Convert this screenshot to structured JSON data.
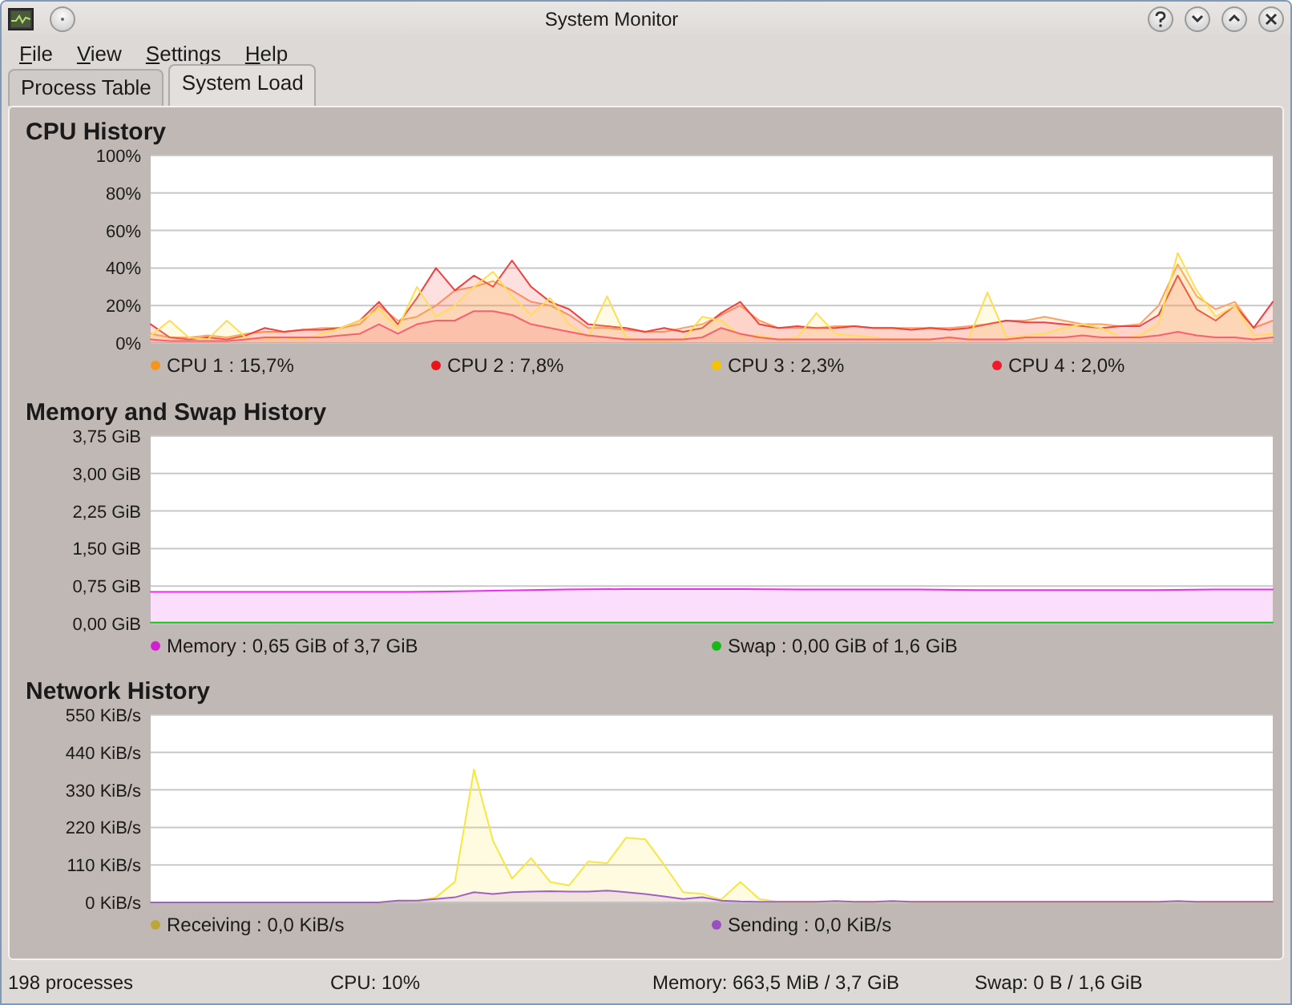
{
  "window": {
    "title": "System Monitor"
  },
  "menu": [
    "File",
    "View",
    "Settings",
    "Help"
  ],
  "tabs": [
    {
      "label": "Process Table",
      "selected": false
    },
    {
      "label": "System Load",
      "selected": true
    }
  ],
  "sections": [
    {
      "title": "CPU History",
      "legend": [
        {
          "reading": ": 15,7%",
          "color": "#f7941d"
        },
        {
          "reading": ": 7,8%",
          "color": "#e8141a"
        },
        {
          "reading": ": 2,3%",
          "color": "#f5c400"
        },
        {
          "reading": ": 2,0%",
          "color": "#ee1b2b"
        }
      ],
      "chart_data": {
        "type": "area",
        "grid": true,
        "ylim": [
          0,
          100
        ],
        "yticks": [
          {
            "value": 0,
            "label": "0%"
          },
          {
            "value": 20,
            "label": "20%"
          },
          {
            "value": 40,
            "label": "40%"
          },
          {
            "value": 60,
            "label": "60%"
          },
          {
            "value": 80,
            "label": "80%"
          },
          {
            "value": 100,
            "label": "100%"
          }
        ],
        "series": [
          {
            "name": "CPU 1",
            "color": "#ffa060",
            "values": [
              5,
              3,
              3,
              4,
              3,
              5,
              6,
              6,
              7,
              8,
              8,
              10,
              20,
              12,
              14,
              20,
              28,
              30,
              33,
              28,
              22,
              20,
              15,
              8,
              8,
              7,
              6,
              6,
              8,
              10,
              15,
              20,
              12,
              8,
              8,
              8,
              9,
              9,
              8,
              8,
              8,
              8,
              8,
              9,
              10,
              12,
              12,
              14,
              12,
              10,
              10,
              9,
              10,
              20,
              42,
              25,
              18,
              22,
              8,
              12
            ]
          },
          {
            "name": "CPU 2",
            "color": "#f04040",
            "values": [
              10,
              3,
              2,
              3,
              2,
              4,
              8,
              6,
              7,
              7,
              8,
              12,
              22,
              10,
              24,
              40,
              28,
              36,
              30,
              44,
              30,
              22,
              18,
              10,
              9,
              8,
              6,
              8,
              6,
              8,
              16,
              22,
              10,
              8,
              9,
              8,
              8,
              9,
              8,
              8,
              7,
              8,
              7,
              8,
              10,
              12,
              11,
              11,
              10,
              9,
              8,
              9,
              9,
              15,
              36,
              18,
              12,
              20,
              8,
              22
            ]
          },
          {
            "name": "CPU 3",
            "color": "#ffdd55",
            "values": [
              4,
              12,
              3,
              2,
              12,
              3,
              2,
              3,
              2,
              5,
              8,
              12,
              18,
              8,
              30,
              14,
              20,
              30,
              38,
              25,
              15,
              24,
              10,
              3,
              25,
              3,
              1,
              1,
              2,
              14,
              12,
              4,
              4,
              2,
              3,
              16,
              5,
              4,
              3,
              2,
              2,
              2,
              3,
              2,
              27,
              3,
              4,
              5,
              8,
              10,
              8,
              3,
              4,
              10,
              48,
              28,
              14,
              20,
              4,
              5
            ]
          },
          {
            "name": "CPU 4",
            "color": "#f86070",
            "values": [
              2,
              1,
              1,
              1,
              1,
              2,
              3,
              3,
              3,
              3,
              4,
              5,
              10,
              5,
              10,
              12,
              12,
              17,
              17,
              15,
              10,
              8,
              6,
              4,
              3,
              2,
              2,
              2,
              2,
              3,
              8,
              5,
              3,
              2,
              2,
              2,
              2,
              2,
              2,
              2,
              2,
              2,
              3,
              2,
              2,
              2,
              3,
              3,
              3,
              4,
              3,
              3,
              3,
              4,
              6,
              4,
              3,
              3,
              2,
              3
            ]
          }
        ]
      }
    },
    {
      "title": "Memory and Swap History",
      "legend": [
        {
          "reading": ": 0,65 GiB of 3,7 GiB",
          "color": "#d020d0"
        },
        {
          "reading": ": 0,00 GiB of 1,6 GiB",
          "color": "#18b818"
        }
      ],
      "chart_data": {
        "type": "area",
        "grid": true,
        "ylim": [
          0,
          3.75
        ],
        "yticks": [
          {
            "value": 0,
            "label": "0,00 GiB"
          },
          {
            "value": 0.75,
            "label": "0,75 GiB"
          },
          {
            "value": 1.5,
            "label": "1,50 GiB"
          },
          {
            "value": 2.25,
            "label": "2,25 GiB"
          },
          {
            "value": 3,
            "label": "3,00 GiB"
          },
          {
            "value": 3.75,
            "label": "3,75 GiB"
          }
        ],
        "series": [
          {
            "name": "Memory",
            "color": "#e830e8",
            "values": [
              0.63,
              0.63,
              0.63,
              0.63,
              0.63,
              0.64,
              0.66,
              0.68,
              0.69,
              0.69,
              0.69,
              0.68,
              0.68,
              0.68,
              0.67,
              0.67,
              0.67,
              0.67,
              0.68,
              0.68
            ]
          },
          {
            "name": "Swap",
            "color": "#20c020",
            "values": [
              0.02,
              0.02,
              0.02,
              0.02,
              0.02,
              0.02,
              0.02,
              0.02,
              0.02,
              0.02,
              0.02,
              0.02,
              0.02,
              0.02,
              0.02,
              0.02,
              0.02,
              0.02,
              0.02,
              0.02
            ]
          }
        ]
      }
    },
    {
      "title": "Network History",
      "legend": [
        {
          "reading": ": 0,0 KiB/s",
          "color": "#bca637"
        },
        {
          "reading": ": 0,0 KiB/s",
          "color": "#9a4fc0"
        }
      ],
      "chart_data": {
        "type": "area",
        "grid": true,
        "ylim": [
          0,
          550
        ],
        "yticks": [
          {
            "value": 0,
            "label": "0 KiB/s"
          },
          {
            "value": 110,
            "label": "110 KiB/s"
          },
          {
            "value": 220,
            "label": "220 KiB/s"
          },
          {
            "value": 330,
            "label": "330 KiB/s"
          },
          {
            "value": 440,
            "label": "440 KiB/s"
          },
          {
            "value": 550,
            "label": "550 KiB/s"
          }
        ],
        "series": [
          {
            "name": "Receiving",
            "color": "#f8e640",
            "values": [
              0,
              0,
              0,
              0,
              0,
              0,
              0,
              0,
              0,
              0,
              0,
              0,
              0,
              5,
              3,
              15,
              60,
              390,
              180,
              70,
              130,
              60,
              50,
              120,
              115,
              190,
              185,
              110,
              30,
              25,
              8,
              60,
              10,
              2,
              2,
              2,
              2,
              2,
              2,
              2,
              2,
              2,
              2,
              2,
              2,
              2,
              2,
              2,
              2,
              2,
              2,
              2,
              2,
              2,
              2,
              2,
              2,
              2,
              2,
              2
            ]
          },
          {
            "name": "Sending",
            "color": "#a060c8",
            "values": [
              0,
              0,
              0,
              0,
              0,
              0,
              0,
              0,
              0,
              0,
              0,
              0,
              0,
              5,
              5,
              10,
              15,
              30,
              25,
              30,
              32,
              33,
              32,
              32,
              35,
              30,
              25,
              18,
              10,
              15,
              5,
              3,
              2,
              2,
              2,
              2,
              4,
              2,
              2,
              4,
              2,
              2,
              2,
              2,
              2,
              2,
              2,
              2,
              2,
              2,
              2,
              2,
              2,
              2,
              4,
              2,
              2,
              2,
              2,
              2
            ]
          }
        ]
      }
    }
  ],
  "status_bar": [
    "198 processes",
    "CPU: 10%",
    "Memory: 663,5 MiB / 3,7 GiB",
    "Swap: 0 B / 1,6 GiB"
  ]
}
